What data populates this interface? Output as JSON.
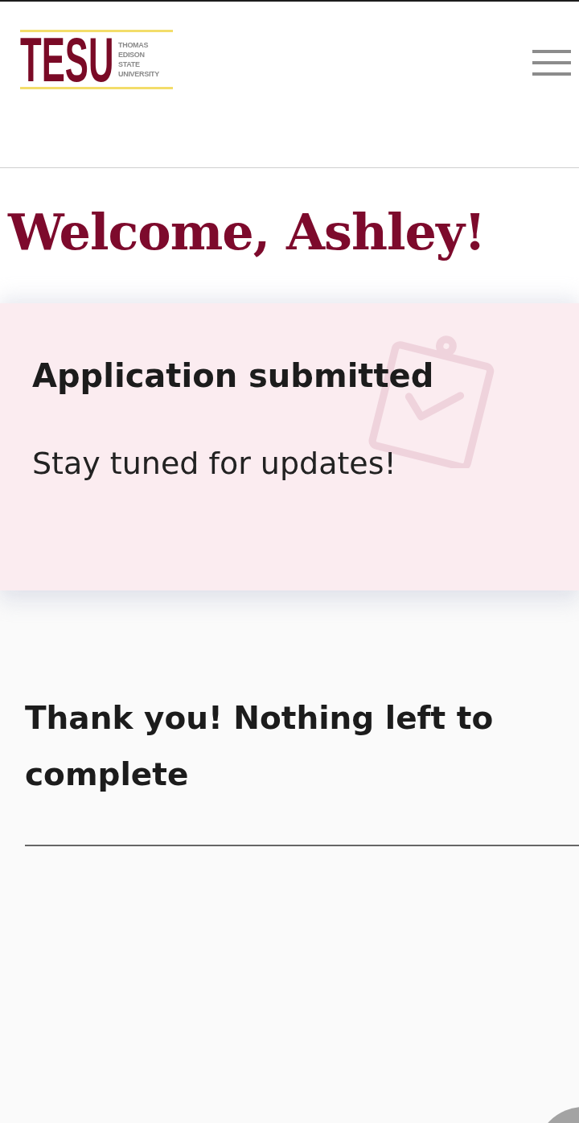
{
  "header": {
    "logo": {
      "abbreviation": "TESU",
      "name_lines": [
        "THOMAS",
        "EDISON",
        "STATE",
        "UNIVERSITY"
      ]
    }
  },
  "welcome": {
    "heading": "Welcome, Ashley!"
  },
  "status_card": {
    "title": "Application submitted",
    "message": "Stay tuned for updates!"
  },
  "tasks": {
    "message": "Thank you! Nothing left to complete"
  }
}
